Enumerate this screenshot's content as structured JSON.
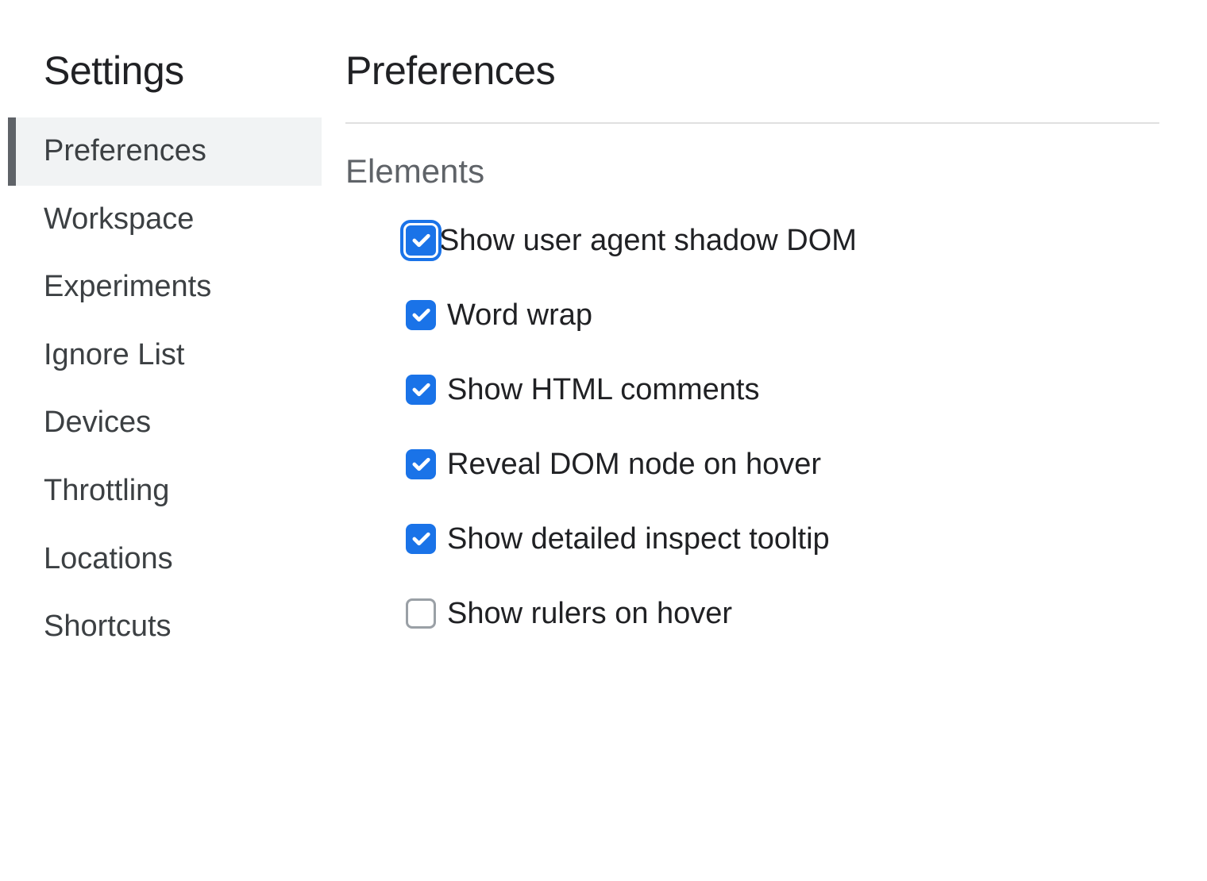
{
  "sidebar": {
    "title": "Settings",
    "items": [
      {
        "label": "Preferences",
        "active": true
      },
      {
        "label": "Workspace",
        "active": false
      },
      {
        "label": "Experiments",
        "active": false
      },
      {
        "label": "Ignore List",
        "active": false
      },
      {
        "label": "Devices",
        "active": false
      },
      {
        "label": "Throttling",
        "active": false
      },
      {
        "label": "Locations",
        "active": false
      },
      {
        "label": "Shortcuts",
        "active": false
      }
    ]
  },
  "main": {
    "title": "Preferences",
    "section_title": "Elements",
    "options": [
      {
        "label": "Show user agent shadow DOM",
        "checked": true,
        "focused": true
      },
      {
        "label": "Word wrap",
        "checked": true,
        "focused": false
      },
      {
        "label": "Show HTML comments",
        "checked": true,
        "focused": false
      },
      {
        "label": "Reveal DOM node on hover",
        "checked": true,
        "focused": false
      },
      {
        "label": "Show detailed inspect tooltip",
        "checked": true,
        "focused": false
      },
      {
        "label": "Show rulers on hover",
        "checked": false,
        "focused": false
      }
    ]
  }
}
